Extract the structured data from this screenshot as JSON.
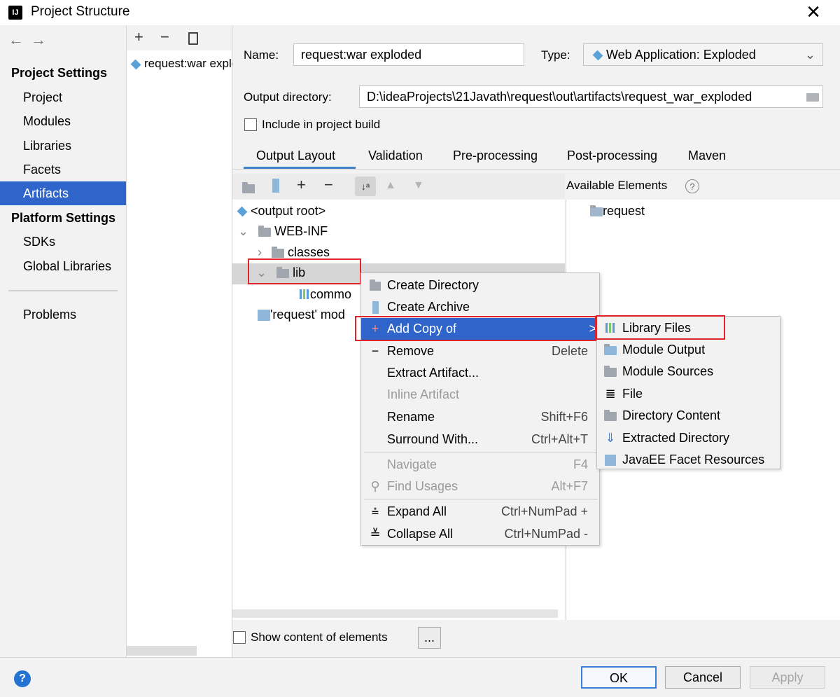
{
  "window": {
    "title": "Project Structure",
    "close_glyph": "✕"
  },
  "nav": {
    "project_settings_header": "Project Settings",
    "project_items": [
      "Project",
      "Modules",
      "Libraries",
      "Facets",
      "Artifacts"
    ],
    "selected": "Artifacts",
    "platform_settings_header": "Platform Settings",
    "platform_items": [
      "SDKs",
      "Global Libraries"
    ],
    "problems": "Problems"
  },
  "artifacts_list": {
    "items": [
      "request:war exploded"
    ]
  },
  "form": {
    "name_label": "Name:",
    "name_value": "request:war exploded",
    "type_label": "Type:",
    "type_value": "Web Application: Exploded",
    "output_dir_label": "Output directory:",
    "output_dir_value": "D:\\ideaProjects\\21Javath\\request\\out\\artifacts\\request_war_exploded",
    "include_build_label": "Include in project build"
  },
  "tabs": [
    "Output Layout",
    "Validation",
    "Pre-processing",
    "Post-processing",
    "Maven"
  ],
  "active_tab": "Output Layout",
  "available_elements": {
    "title": "Available Elements",
    "items": [
      "request"
    ]
  },
  "tree": {
    "output_root": "<output root>",
    "web_inf": "WEB-INF",
    "classes": "classes",
    "lib": "lib",
    "lib_child": "commo",
    "module_output": "'request' mod"
  },
  "context_menu": {
    "items": [
      {
        "label": "Create Directory",
        "shortcut": "",
        "icon": "folder-plus-icon"
      },
      {
        "label": "Create Archive",
        "shortcut": "",
        "icon": "archive-icon"
      },
      {
        "label": "Add Copy of",
        "shortcut": "",
        "icon": "plus-icon",
        "arrow": ">"
      },
      {
        "label": "Remove",
        "shortcut": "Delete",
        "icon": "minus-icon"
      },
      {
        "label": "Extract Artifact...",
        "shortcut": ""
      },
      {
        "label": "Inline Artifact",
        "shortcut": "",
        "disabled": true
      },
      {
        "label": "Rename",
        "shortcut": "Shift+F6"
      },
      {
        "label": "Surround With...",
        "shortcut": "Ctrl+Alt+T"
      },
      {
        "label": "Navigate",
        "shortcut": "F4",
        "disabled": true
      },
      {
        "label": "Find Usages",
        "shortcut": "Alt+F7",
        "disabled": true,
        "icon": "search-icon"
      },
      {
        "label": "Expand All",
        "shortcut": "Ctrl+NumPad +",
        "icon": "expand-all-icon"
      },
      {
        "label": "Collapse All",
        "shortcut": "Ctrl+NumPad -",
        "icon": "collapse-all-icon"
      }
    ]
  },
  "submenu": {
    "items": [
      "Library Files",
      "Module Output",
      "Module Sources",
      "File",
      "Directory Content",
      "Extracted Directory",
      "JavaEE Facet Resources"
    ]
  },
  "bottom": {
    "show_content_label": "Show content of elements",
    "ellipsis_button": "...",
    "ok": "OK",
    "cancel": "Cancel",
    "apply": "Apply",
    "help_glyph": "?"
  },
  "colors": {
    "selection": "#2f65ca",
    "highlight_box": "#e0252a",
    "tab_underline": "#4083c9"
  }
}
